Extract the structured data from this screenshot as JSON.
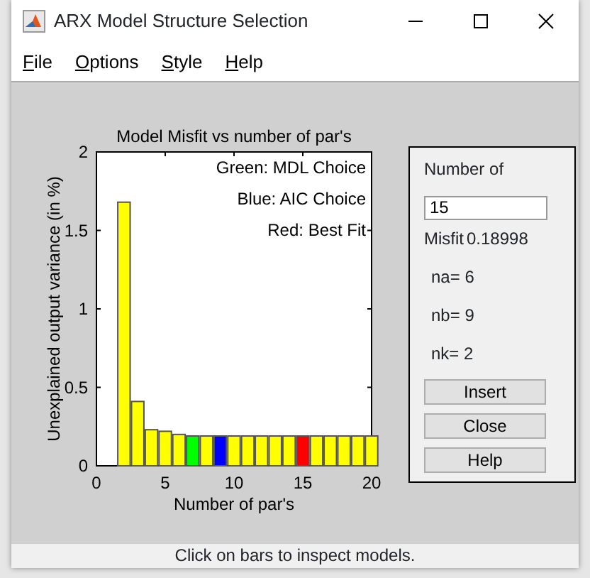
{
  "window": {
    "title": "ARX Model Structure Selection"
  },
  "menu": [
    {
      "label": "File"
    },
    {
      "label": "Options"
    },
    {
      "label": "Style"
    },
    {
      "label": "Help"
    }
  ],
  "chart": {
    "chart_data": {
      "type": "bar",
      "title": "Model Misfit vs number of par's",
      "xlabel": "Number of par's",
      "ylabel": "Unexplained output variance (in %)",
      "x": [
        2,
        3,
        4,
        5,
        6,
        7,
        8,
        9,
        10,
        11,
        12,
        13,
        14,
        15,
        16,
        17,
        18,
        19,
        20
      ],
      "series": [
        {
          "color": "#ffff00",
          "values": [
            1.68,
            0.41,
            0.23,
            0.22,
            0.2,
            null,
            0.19,
            null,
            0.19,
            0.19,
            0.19,
            0.19,
            0.19,
            null,
            0.19,
            0.19,
            0.19,
            0.19,
            0.19
          ]
        },
        {
          "color": "#00ff00",
          "values": [
            null,
            null,
            null,
            null,
            null,
            0.19,
            null,
            null,
            null,
            null,
            null,
            null,
            null,
            null,
            null,
            null,
            null,
            null,
            null
          ]
        },
        {
          "color": "#0000ff",
          "values": [
            null,
            null,
            null,
            null,
            null,
            null,
            null,
            0.19,
            null,
            null,
            null,
            null,
            null,
            null,
            null,
            null,
            null,
            null,
            null
          ]
        },
        {
          "color": "#ff0000",
          "values": [
            null,
            null,
            null,
            null,
            null,
            null,
            null,
            null,
            null,
            null,
            null,
            null,
            null,
            0.19,
            null,
            null,
            null,
            null,
            null
          ]
        }
      ],
      "xlim": [
        0,
        20
      ],
      "ylim": [
        0,
        2
      ],
      "xticks": [
        0,
        5,
        10,
        15,
        20
      ],
      "yticks": [
        0,
        0.5,
        1,
        1.5,
        2
      ],
      "annotations": [
        "Green: MDL Choice",
        "Blue: AIC Choice",
        "Red: Best Fit"
      ]
    }
  },
  "panel": {
    "heading": "Number of",
    "value": "15",
    "misfit_label": "Misfit",
    "misfit_value": "0.18998",
    "orders": [
      "na= 6",
      "nb= 9",
      "nk= 2"
    ],
    "buttons": [
      "Insert",
      "Close",
      "Help"
    ]
  },
  "status_bar": "Click on bars to inspect models."
}
